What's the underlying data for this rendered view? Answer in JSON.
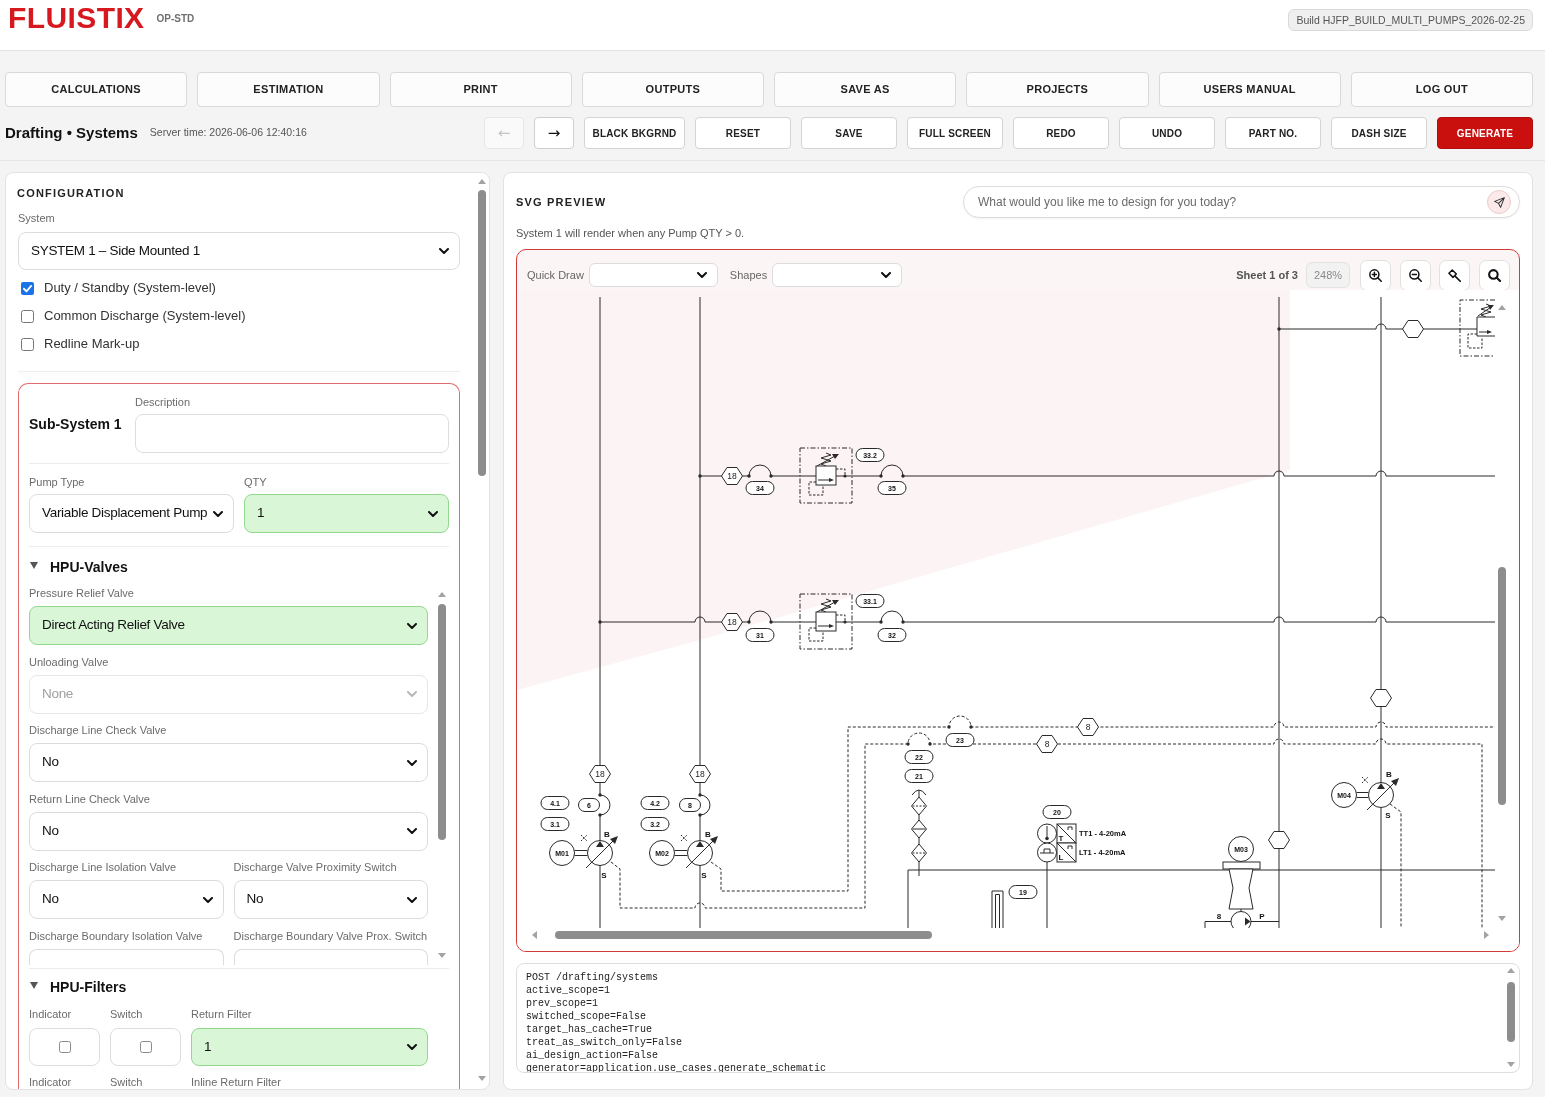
{
  "header": {
    "logo": "FLUISTIX",
    "edition": "OP-STD",
    "build": "Build HJFP_BUILD_MULTI_PUMPS_2026-02-25"
  },
  "nav": [
    {
      "label": "CALCULATIONS"
    },
    {
      "label": "ESTIMATION"
    },
    {
      "label": "PRINT"
    },
    {
      "label": "OUTPUTS"
    },
    {
      "label": "SAVE AS"
    },
    {
      "label": "PROJECTS"
    },
    {
      "label": "USERS MANUAL"
    },
    {
      "label": "LOG OUT"
    }
  ],
  "toolbar": {
    "title": "Drafting • Systems",
    "server_time": "Server time: 2026-06-06 12:40:16",
    "history": [
      {
        "label": "←",
        "disabled": true
      },
      {
        "label": "→",
        "disabled": false
      }
    ],
    "buttons": [
      {
        "label": "BLACK BKGRND",
        "kind": "default"
      },
      {
        "label": "RESET",
        "kind": "default"
      },
      {
        "label": "SAVE",
        "kind": "default"
      },
      {
        "label": "FULL SCREEN",
        "kind": "default"
      },
      {
        "label": "REDO",
        "kind": "default"
      },
      {
        "label": "UNDO",
        "kind": "default"
      },
      {
        "label": "PART NO.",
        "kind": "default"
      },
      {
        "label": "DASH SIZE",
        "kind": "default"
      },
      {
        "label": "GENERATE",
        "kind": "primary"
      }
    ]
  },
  "configuration": {
    "heading": "CONFIGURATION",
    "system": {
      "label": "System",
      "value": "SYSTEM 1 – Side Mounted 1"
    },
    "options": [
      {
        "label": "Duty / Standby (System-level)",
        "checked": true
      },
      {
        "label": "Common Discharge (System-level)",
        "checked": false
      },
      {
        "label": "Redline Mark-up",
        "checked": false
      }
    ]
  },
  "subsystem": {
    "title": "Sub-System 1",
    "description": {
      "label": "Description"
    },
    "pump_type": {
      "label": "Pump Type",
      "value": "Variable Displacement Pump",
      "highlighted": false
    },
    "qty": {
      "label": "QTY",
      "value": "1",
      "highlighted": true
    },
    "valves": {
      "title": "HPU-Valves",
      "expanded": true,
      "rows": [
        {
          "fields": [
            {
              "label": "Pressure Relief Valve",
              "value": "Direct Acting Relief Valve",
              "highlighted": true,
              "disabled": false
            }
          ]
        },
        {
          "fields": [
            {
              "label": "Unloading Valve",
              "value": "None",
              "highlighted": false,
              "disabled": true
            }
          ]
        },
        {
          "fields": [
            {
              "label": "Discharge Line Check Valve",
              "value": "No",
              "highlighted": false,
              "disabled": false
            }
          ]
        },
        {
          "fields": [
            {
              "label": "Return Line Check Valve",
              "value": "No",
              "highlighted": false,
              "disabled": false
            }
          ]
        },
        {
          "fields": [
            {
              "label": "Discharge Line Isolation Valve",
              "value": "No",
              "highlighted": false,
              "disabled": false
            },
            {
              "label": "Discharge Valve Proximity Switch",
              "value": "No",
              "highlighted": false,
              "disabled": false
            }
          ]
        },
        {
          "fields": [
            {
              "label": "Discharge Boundary Isolation Valve",
              "highlighted": false
            },
            {
              "label": "Discharge Boundary Valve Prox. Switch",
              "highlighted": false
            }
          ]
        }
      ]
    },
    "filters": {
      "title": "HPU-Filters",
      "expanded": true,
      "rows": [
        {
          "fields": [
            {
              "kind": "checkbox",
              "label": "Indicator",
              "checked": false
            },
            {
              "kind": "checkbox",
              "label": "Switch",
              "checked": false
            },
            {
              "kind": "select",
              "label": "Return Filter",
              "value": "1",
              "highlighted": true
            }
          ]
        },
        {
          "fields": [
            {
              "kind": "caption",
              "label": "Indicator"
            },
            {
              "kind": "caption",
              "label": "Switch"
            },
            {
              "kind": "caption",
              "label": "Inline Return Filter"
            }
          ]
        }
      ]
    }
  },
  "preview": {
    "heading": "SVG PREVIEW",
    "chat": {
      "placeholder": "What would you like me to design for you today?"
    },
    "notice": "System 1 will render when any Pump QTY > 0.",
    "canvas": {
      "quick_draw": {
        "label": "Quick Draw"
      },
      "shapes": {
        "label": "Shapes"
      },
      "sheet": "Sheet 1 of 3",
      "zoom": "248%",
      "schematic": {
        "tags": [
          {
            "kind": "hex",
            "text": "18"
          },
          {
            "kind": "pill",
            "text": "34"
          },
          {
            "kind": "pill",
            "text": "33.2"
          },
          {
            "kind": "pill",
            "text": "35"
          },
          {
            "kind": "hex",
            "text": "18"
          },
          {
            "kind": "pill",
            "text": "31"
          },
          {
            "kind": "pill",
            "text": "33.1"
          },
          {
            "kind": "pill",
            "text": "32"
          },
          {
            "kind": "hex",
            "text": "8"
          },
          {
            "kind": "pill",
            "text": "23"
          },
          {
            "kind": "hex",
            "text": "8"
          },
          {
            "kind": "pill",
            "text": "22"
          },
          {
            "kind": "pill",
            "text": "21"
          },
          {
            "kind": "hex",
            "text": "18"
          },
          {
            "kind": "hex",
            "text": "18"
          },
          {
            "kind": "pill",
            "text": "4.1"
          },
          {
            "kind": "pill",
            "text": "6"
          },
          {
            "kind": "pill",
            "text": "3.1"
          },
          {
            "kind": "pill",
            "text": "4.2"
          },
          {
            "kind": "pill",
            "text": "8"
          },
          {
            "kind": "pill",
            "text": "3.2"
          },
          {
            "kind": "circle",
            "text": "M04"
          },
          {
            "kind": "pill",
            "text": "20"
          },
          {
            "kind": "circle",
            "text": "M01"
          },
          {
            "kind": "circle",
            "text": "M02"
          },
          {
            "kind": "circle",
            "text": "M03"
          },
          {
            "kind": "pill",
            "text": "19"
          }
        ],
        "instrument_labels": [
          {
            "text": "TT1 - 4-20mA"
          },
          {
            "text": "LT1 - 4-20mA"
          }
        ],
        "port_letters": [
          {
            "text": "B"
          },
          {
            "text": "S"
          },
          {
            "text": "B"
          },
          {
            "text": "S"
          },
          {
            "text": "B"
          },
          {
            "text": "S"
          },
          {
            "text": "T"
          },
          {
            "text": "L"
          },
          {
            "text": "8"
          },
          {
            "text": "P"
          }
        ]
      }
    }
  },
  "console": {
    "lines": [
      "POST /drafting/systems",
      "active_scope=1",
      "prev_scope=1",
      "switched_scope=False",
      "target_has_cache=True",
      "treat_as_switch_only=False",
      "ai_design_action=False",
      "generator=application.use_cases.generate_schematic"
    ]
  }
}
